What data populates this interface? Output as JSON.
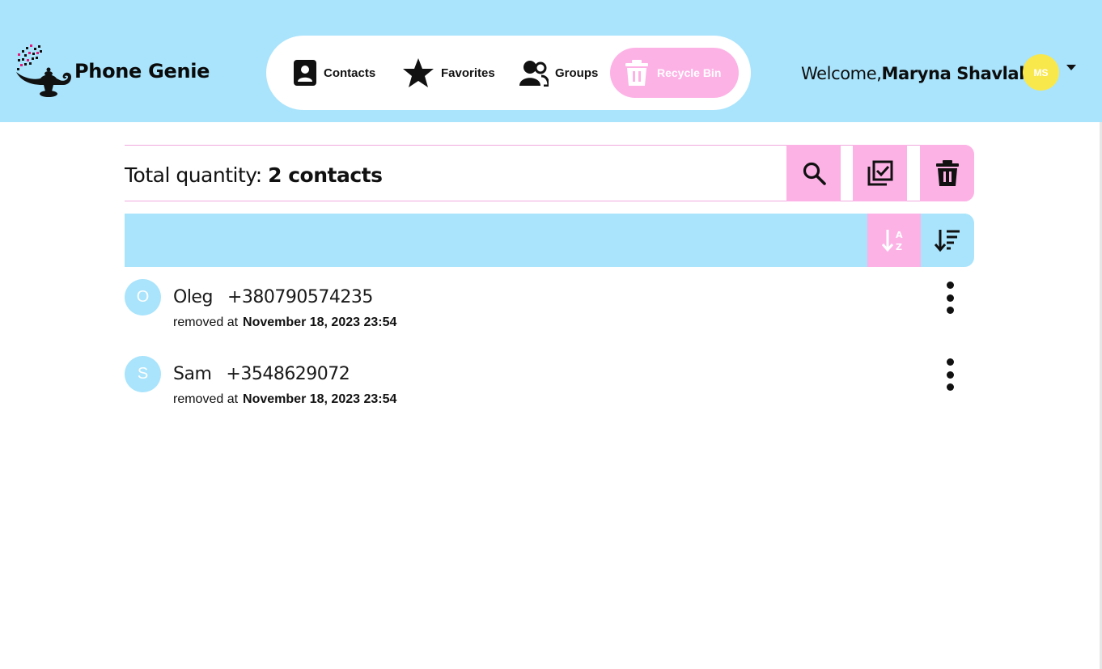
{
  "app": {
    "name": "Phone Genie"
  },
  "nav": {
    "items": [
      {
        "label": "Contacts",
        "icon": "contact-book-icon"
      },
      {
        "label": "Favorites",
        "icon": "star-icon"
      },
      {
        "label": "Groups",
        "icon": "group-icon"
      },
      {
        "label": "Recycle Bin",
        "icon": "trash-icon",
        "active": true
      }
    ]
  },
  "user": {
    "welcome_prefix": "Welcome,",
    "name": "Maryna Shavlak!",
    "initials": "MS"
  },
  "toolbar": {
    "total_label": "Total quantity: ",
    "total_value": "2 contacts",
    "buttons": [
      "search-icon",
      "select-all-icon",
      "delete-icon"
    ]
  },
  "sort": {
    "buttons": [
      "sort-alpha-icon",
      "sort-list-icon"
    ],
    "active": "alpha"
  },
  "contacts": [
    {
      "initial": "O",
      "name": "Oleg",
      "phone": "+380790574235",
      "removed_label": "removed at",
      "removed_date": "November 18, 2023 23:54"
    },
    {
      "initial": "S",
      "name": "Sam",
      "phone": "+3548629072",
      "removed_label": "removed at",
      "removed_date": "November 18, 2023 23:54"
    }
  ],
  "colors": {
    "header_bg": "#a9e4fc",
    "accent_pink": "#fdb2e6",
    "avatar_yellow": "#f9e84b"
  }
}
